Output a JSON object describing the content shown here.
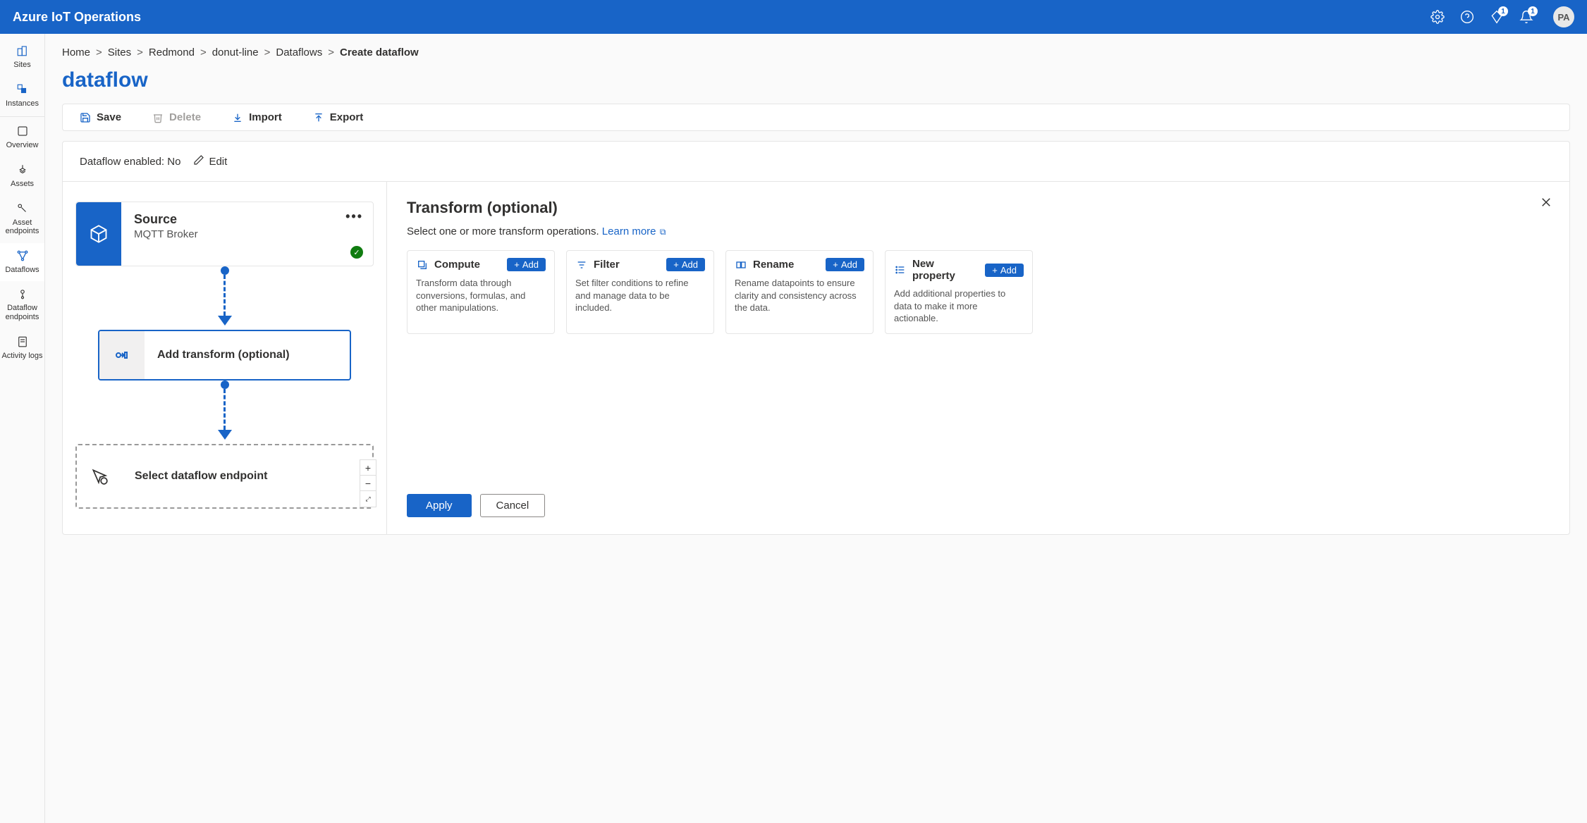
{
  "header": {
    "title": "Azure IoT Operations",
    "avatar": "PA",
    "badge1": "1",
    "badge2": "1"
  },
  "sidenav": {
    "sites": "Sites",
    "instances": "Instances",
    "overview": "Overview",
    "assets": "Assets",
    "asset_endpoints": "Asset endpoints",
    "dataflows": "Dataflows",
    "dataflow_endpoints": "Dataflow endpoints",
    "activity_logs": "Activity logs"
  },
  "breadcrumbs": {
    "home": "Home",
    "sites": "Sites",
    "redmond": "Redmond",
    "donut": "donut-line",
    "dataflows": "Dataflows",
    "create": "Create dataflow",
    "sep": ">"
  },
  "page_title": "dataflow",
  "toolbar": {
    "save": "Save",
    "delete": "Delete",
    "import": "Import",
    "export": "Export"
  },
  "enable_row": {
    "label": "Dataflow enabled: No",
    "edit": "Edit"
  },
  "canvas": {
    "source_title": "Source",
    "source_sub": "MQTT Broker",
    "transform_label": "Add transform (optional)",
    "endpoint_label": "Select dataflow endpoint"
  },
  "rpanel": {
    "title": "Transform (optional)",
    "subtext": "Select one or more transform operations. ",
    "learn": "Learn more",
    "apply": "Apply",
    "cancel": "Cancel",
    "add": "Add",
    "cards": {
      "compute_title": "Compute",
      "compute_desc": "Transform data through conversions, formulas, and other manipulations.",
      "filter_title": "Filter",
      "filter_desc": "Set filter conditions to refine and manage data to be included.",
      "rename_title": "Rename",
      "rename_desc": "Rename datapoints to ensure clarity and consistency across the data.",
      "newprop_title": "New property",
      "newprop_desc": "Add additional properties to data to make it more actionable."
    }
  }
}
